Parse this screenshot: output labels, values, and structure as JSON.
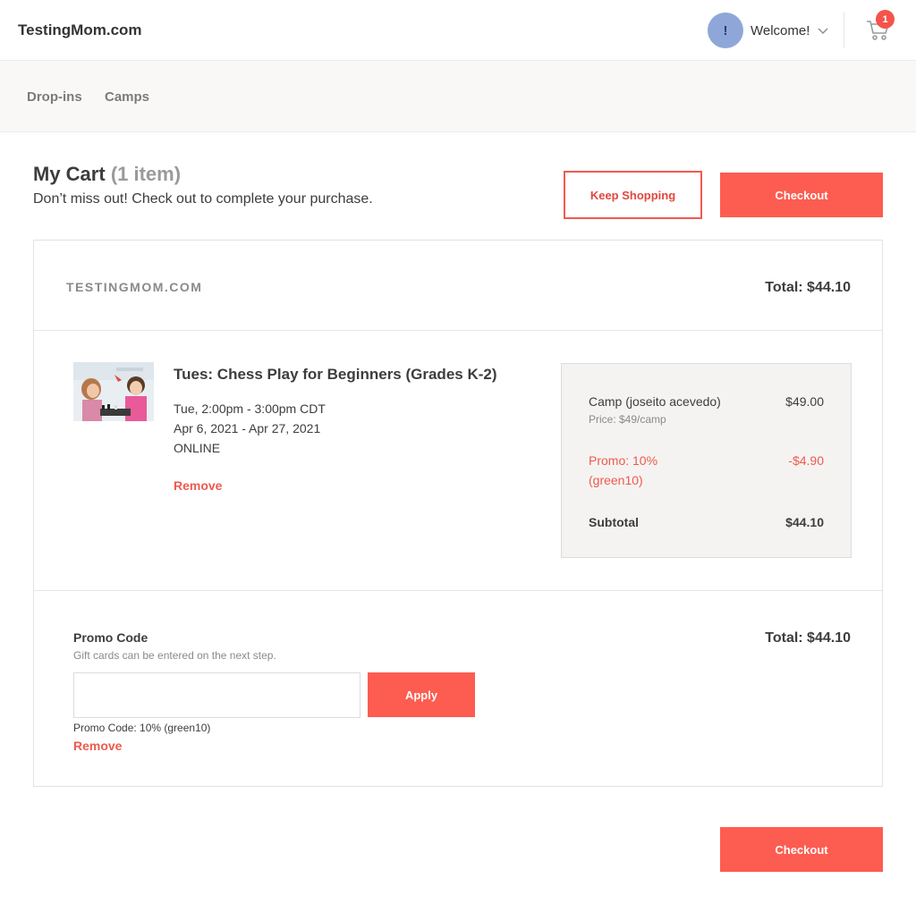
{
  "header": {
    "logo": "TestingMom.com",
    "avatar_initial": "!",
    "welcome": "Welcome!",
    "cart_count": "1"
  },
  "subnav": {
    "items": [
      {
        "label": "Drop-ins"
      },
      {
        "label": "Camps"
      }
    ]
  },
  "cart": {
    "title": "My Cart",
    "item_count": "(1 item)",
    "subtitle": "Don’t miss out! Check out to complete your purchase.",
    "keep_shopping_label": "Keep Shopping",
    "checkout_label": "Checkout"
  },
  "vendor": {
    "name": "TESTINGMOM.COM",
    "total": "Total: $44.10"
  },
  "item": {
    "title": "Tues: Chess Play for Beginners (Grades K-2)",
    "time": "Tue, 2:00pm - 3:00pm CDT",
    "dates": "Apr 6, 2021 - Apr 27, 2021",
    "location": "ONLINE",
    "remove_label": "Remove"
  },
  "summary": {
    "line_label": "Camp (joseito acevedo)",
    "line_amount": "$49.00",
    "price_note": "Price: $49/camp",
    "promo_label_1": "Promo: 10%",
    "promo_label_2": "(green10)",
    "promo_amount": "-$4.90",
    "subtotal_label": "Subtotal",
    "subtotal_amount": "$44.10"
  },
  "promo": {
    "label": "Promo Code",
    "help": "Gift cards can be entered on the next step.",
    "input_value": "",
    "apply_label": "Apply",
    "applied_text": "Promo Code: 10% (green10)",
    "remove_label": "Remove",
    "total": "Total: $44.10"
  },
  "footer": {
    "checkout_label": "Checkout"
  },
  "colors": {
    "accent": "#fd5c50",
    "accent_text": "#ee5a4e",
    "avatar": "#8ea7d8",
    "subnav_bg": "#faf8f6",
    "summary_bg": "#f4f3f1"
  },
  "icons": {
    "chevron": "chevron-down-icon",
    "cart": "shopping-cart-icon"
  }
}
